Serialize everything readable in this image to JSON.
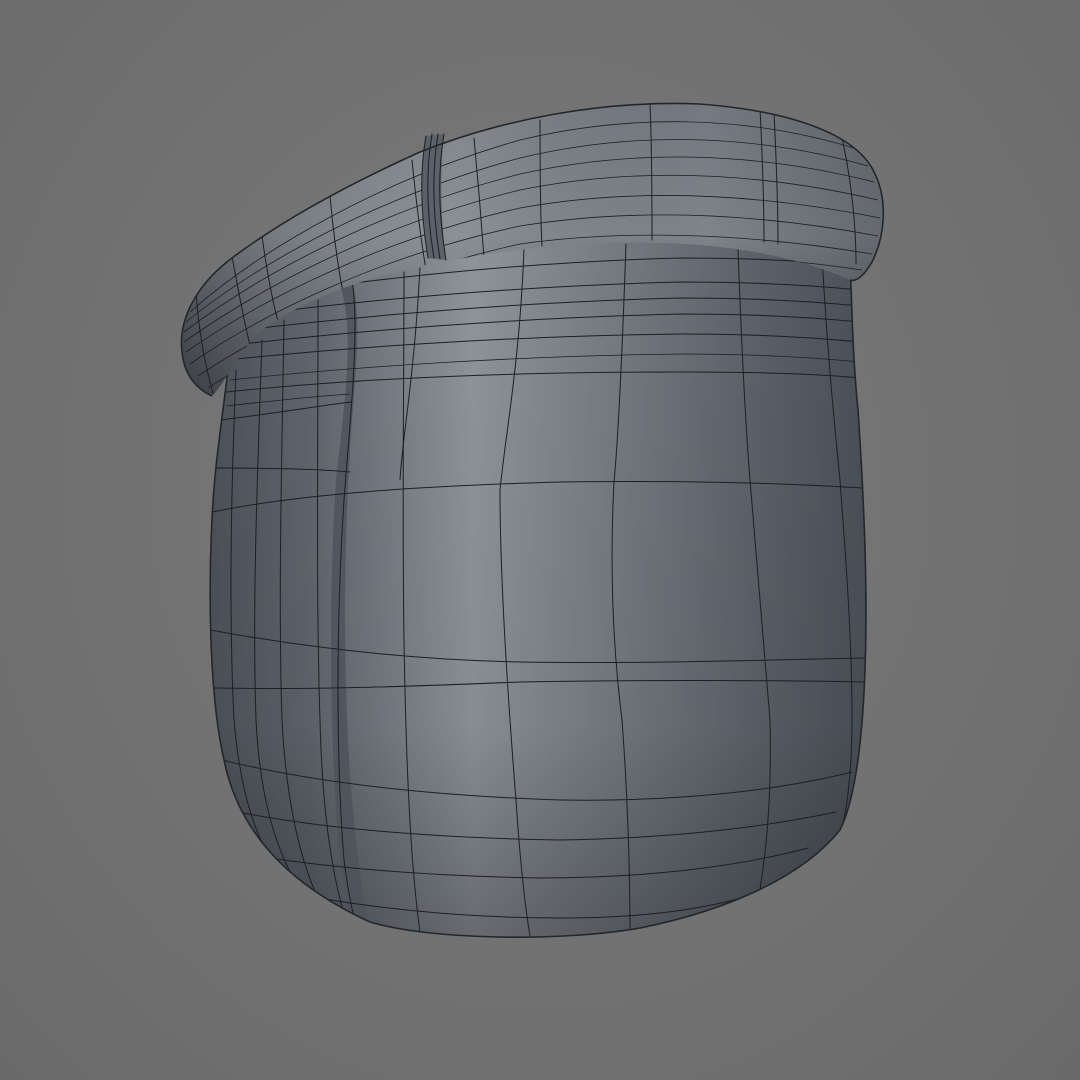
{
  "viewport": {
    "background_color": "#727272",
    "shading_mode": "wireframe-on-shaded"
  },
  "model": {
    "name": "",
    "surface_color": "#5f666e",
    "highlight_color": "#9aa0a6",
    "wire_color": "#1c1f23"
  }
}
